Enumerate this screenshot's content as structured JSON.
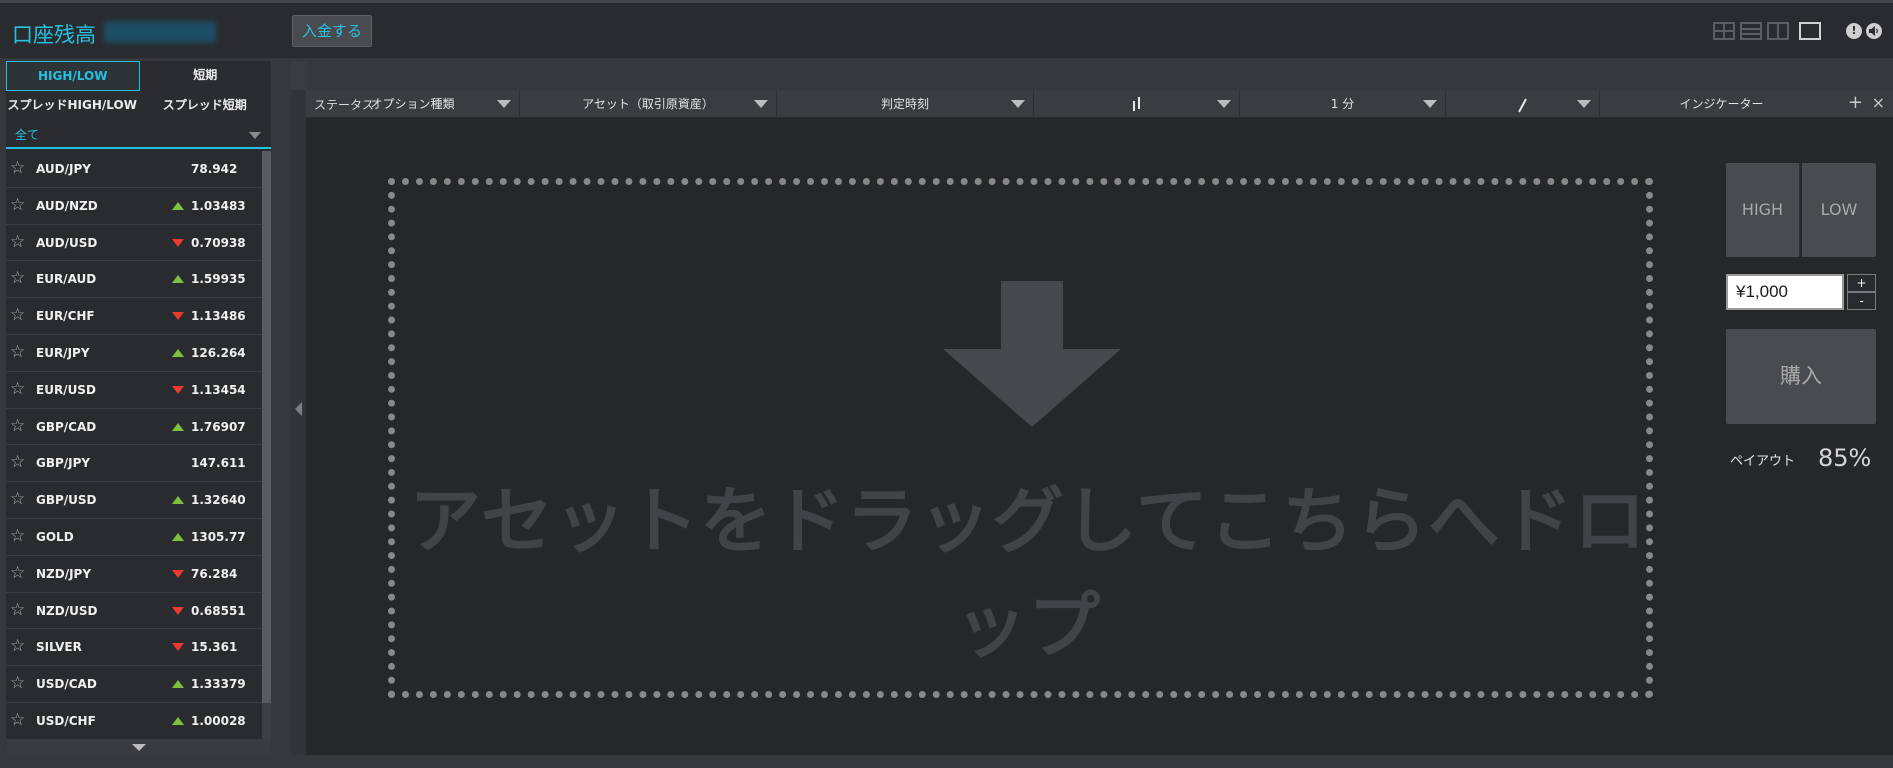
{
  "header": {
    "balance_label": "口座残高",
    "deposit_label": "入金する",
    "layout_icons": [
      "layout-grid-icon",
      "layout-rows-icon",
      "layout-columns-icon",
      "layout-single-icon"
    ],
    "alert_icon": "!",
    "sound_icon": "speaker-icon"
  },
  "sidebar": {
    "tabs": [
      "HIGH/LOW",
      "短期"
    ],
    "tabs2": [
      "スプレッドHIGH/LOW",
      "スプレッド短期"
    ],
    "category": "全て",
    "assets": [
      {
        "name": "AUD/JPY",
        "trend": "none",
        "price": "78.942"
      },
      {
        "name": "AUD/NZD",
        "trend": "up",
        "price": "1.03483"
      },
      {
        "name": "AUD/USD",
        "trend": "down",
        "price": "0.70938"
      },
      {
        "name": "EUR/AUD",
        "trend": "up",
        "price": "1.59935"
      },
      {
        "name": "EUR/CHF",
        "trend": "down",
        "price": "1.13486"
      },
      {
        "name": "EUR/JPY",
        "trend": "up",
        "price": "126.264"
      },
      {
        "name": "EUR/USD",
        "trend": "down",
        "price": "1.13454"
      },
      {
        "name": "GBP/CAD",
        "trend": "up",
        "price": "1.76907"
      },
      {
        "name": "GBP/JPY",
        "trend": "none",
        "price": "147.611"
      },
      {
        "name": "GBP/USD",
        "trend": "up",
        "price": "1.32640"
      },
      {
        "name": "GOLD",
        "trend": "up",
        "price": "1305.77"
      },
      {
        "name": "NZD/JPY",
        "trend": "down",
        "price": "76.284"
      },
      {
        "name": "NZD/USD",
        "trend": "down",
        "price": "0.68551"
      },
      {
        "name": "SILVER",
        "trend": "down",
        "price": "15.361"
      },
      {
        "name": "USD/CAD",
        "trend": "up",
        "price": "1.33379"
      },
      {
        "name": "USD/CHF",
        "trend": "up",
        "price": "1.00028"
      }
    ]
  },
  "toolbar": {
    "option_type": "オプション種類",
    "asset": "アセット（取引原資産）",
    "judge_time": "判定時刻",
    "interval": "1 分",
    "indicator": "インジケーター",
    "plus": "+",
    "close": "×"
  },
  "main": {
    "status_label": "ステータス:",
    "drop_text": "アセットをドラッグしてこちらへドロップ"
  },
  "trade": {
    "high_label": "HIGH",
    "low_label": "LOW",
    "amount": "¥1,000",
    "plus": "+",
    "minus": "-",
    "buy_label": "購入",
    "payout_label": "ペイアウト",
    "payout_value": "85%"
  },
  "colors": {
    "accent": "#25c0e2",
    "up": "#7dc142",
    "down": "#e83a2f"
  }
}
